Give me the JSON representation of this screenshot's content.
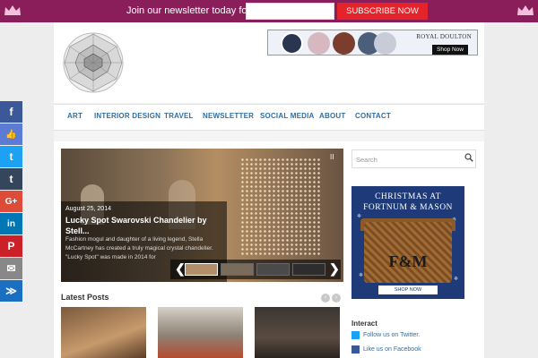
{
  "newsletter": {
    "text": "Join our newsletter today for free.",
    "input_placeholder": "",
    "button_label": "SUBSCRIBE NOW"
  },
  "social_bar": [
    {
      "icon": "facebook-icon",
      "glyph": "f",
      "color": "#3b5998"
    },
    {
      "icon": "like-icon",
      "glyph": "👍",
      "color": "#5b7bd5"
    },
    {
      "icon": "twitter-icon",
      "glyph": "t",
      "color": "#1da1f2"
    },
    {
      "icon": "tumblr-icon",
      "glyph": "t",
      "color": "#35465c"
    },
    {
      "icon": "google-plus-icon",
      "glyph": "G+",
      "color": "#dd4b39"
    },
    {
      "icon": "linkedin-icon",
      "glyph": "in",
      "color": "#0077b5"
    },
    {
      "icon": "pinterest-icon",
      "glyph": "P",
      "color": "#cb2027"
    },
    {
      "icon": "email-icon",
      "glyph": "✉",
      "color": "#888888"
    },
    {
      "icon": "share-icon",
      "glyph": "≫",
      "color": "#1a6fc0"
    }
  ],
  "header_ad": {
    "brand": "ROYAL DOULTON",
    "shop_label": "Shop Now"
  },
  "nav": [
    "ART",
    "INTERIOR DESIGN",
    "TRAVEL",
    "NEWSLETTER",
    "SOCIAL MEDIA",
    "ABOUT",
    "CONTACT"
  ],
  "slider": {
    "date": "August 25, 2014",
    "title": "Lucky Spot Swarovski Chandelier by Stell...",
    "excerpt": "Fashion mogul and daughter of a living legend, Stella McCartney has created a truly magical crystal chandelier. \"Lucky Spot\" was made in 2014 for",
    "pause_glyph": "II",
    "prev_glyph": "❮",
    "next_glyph": "❯"
  },
  "latest": {
    "title": "Latest Posts",
    "prev_glyph": "‹",
    "next_glyph": "›"
  },
  "search": {
    "placeholder": "Search"
  },
  "sidebar_ad": {
    "title_line1": "CHRISTMAS AT",
    "title_line2": "FORTNUM & MASON",
    "logo": "F&M",
    "shop_label": "SHOP NOW"
  },
  "interact": {
    "title": "Interact",
    "items": [
      {
        "label": "Follow us on Twitter.",
        "icon": "twitter-icon"
      },
      {
        "label": "Like us on Facebook",
        "icon": "facebook-icon"
      }
    ]
  },
  "colors": {
    "topbar": "#8a1e5a",
    "subscribe": "#e4232a",
    "nav_text": "#2f6fa5"
  }
}
